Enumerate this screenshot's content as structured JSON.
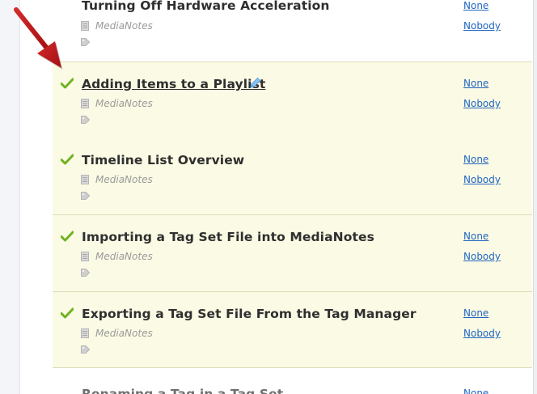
{
  "rows": [
    {
      "title": "Turning Off Hardware Acceleration",
      "project": "MediaNotes",
      "link1": "None",
      "link2": "Nobody"
    },
    {
      "title": "Adding Items to a Playlist",
      "project": "MediaNotes",
      "link1": "None",
      "link2": "Nobody"
    },
    {
      "title": "Timeline List Overview",
      "project": "MediaNotes",
      "link1": "None",
      "link2": "Nobody"
    },
    {
      "title": "Importing a Tag Set File into MediaNotes",
      "project": "MediaNotes",
      "link1": "None",
      "link2": "Nobody"
    },
    {
      "title": "Exporting a Tag Set File From the Tag Manager",
      "project": "MediaNotes",
      "link1": "None",
      "link2": "Nobody"
    },
    {
      "title": "Renaming a Tag in a Tag Set",
      "link1": "None"
    }
  ],
  "colors": {
    "highlight_row": "#fbfae4",
    "link": "#2166c2",
    "check": "#6fb320",
    "arrow": "#c0161b",
    "pencil": "#5aa6e6"
  },
  "icons": {
    "check": "green-check-icon",
    "doc": "document-icon",
    "tag": "tag-icon",
    "edit": "pencil-edit-icon",
    "arrow": "red-arrow-annotation"
  }
}
